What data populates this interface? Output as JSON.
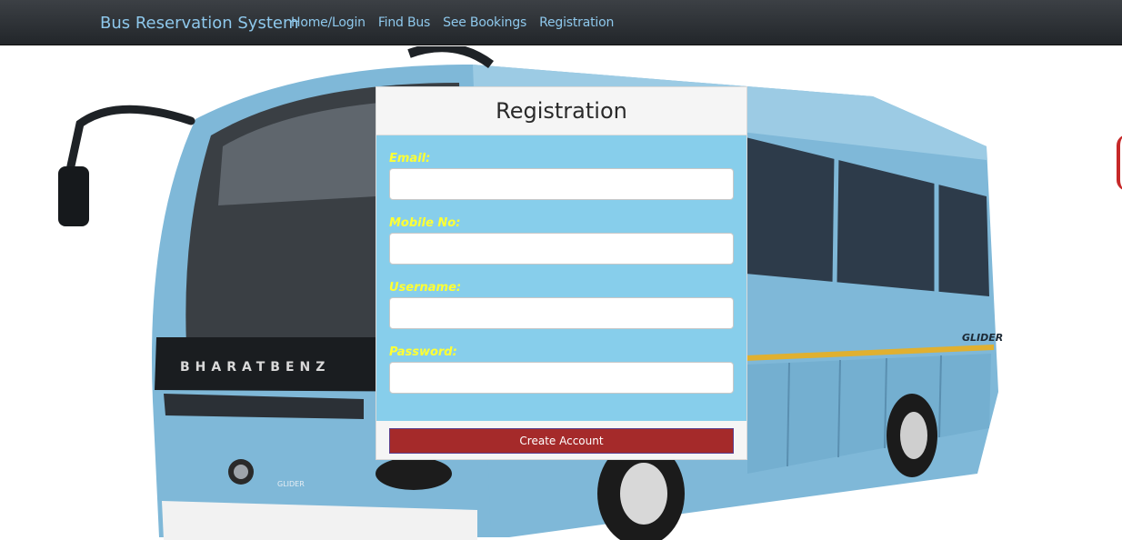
{
  "navbar": {
    "brand": "Bus Reservation System",
    "links": [
      "Home/Login",
      "Find Bus",
      "See Bookings",
      "Registration"
    ]
  },
  "hero": {
    "bus_front_badge": "BHARATBENZ",
    "bus_side_logo": "GLIDER",
    "bus_front_logo": "GLIDER"
  },
  "form": {
    "title": "Registration",
    "fields": [
      {
        "label": "Email:",
        "value": ""
      },
      {
        "label": "Mobile No:",
        "value": ""
      },
      {
        "label": "Username:",
        "value": ""
      },
      {
        "label": "Password:",
        "value": ""
      }
    ],
    "submit_label": "Create Account"
  },
  "colors": {
    "navbar_bg": "#2b2f33",
    "nav_text": "#8ec8ec",
    "form_body": "#87ceeb",
    "label_text": "#ffff33",
    "button_bg": "#a52a2a",
    "bus_body": "#7fb8d8"
  }
}
